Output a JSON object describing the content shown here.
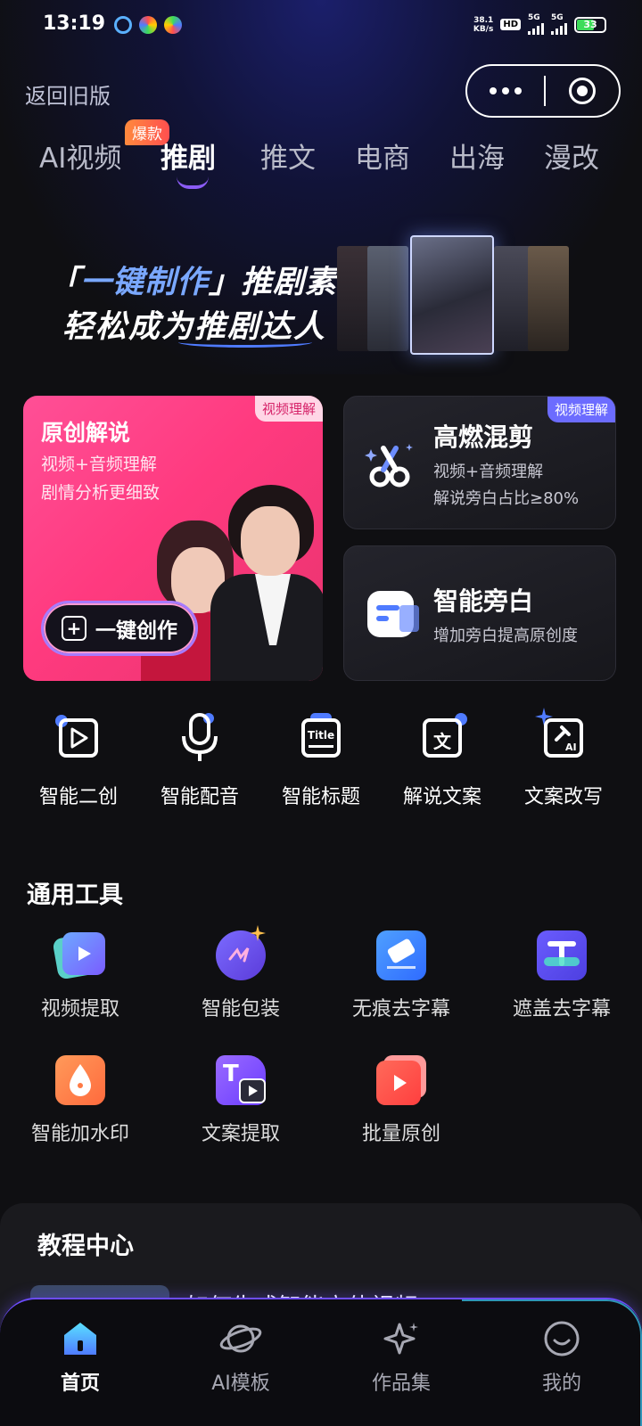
{
  "status_bar": {
    "time": "13:19",
    "net_speed_value": "38.1",
    "net_speed_unit": "KB/s",
    "hd_label": "HD",
    "hd_sub": "1 2",
    "signal1_label": "5G",
    "signal2_label": "5G",
    "battery_level": "33"
  },
  "header": {
    "back_label": "返回旧版"
  },
  "tabs": [
    {
      "label": "AI视频"
    },
    {
      "label": "推剧"
    },
    {
      "label": "推文"
    },
    {
      "label": "电商"
    },
    {
      "label": "出海"
    },
    {
      "label": "漫改"
    }
  ],
  "hot_badge": "爆款",
  "hero": {
    "line1_bracket_open": "「",
    "line1_highlight": "一键制作",
    "line1_bracket_close": "」",
    "line1_rest": "推剧素材",
    "line2": "轻松成为推剧达人"
  },
  "cards": {
    "original": {
      "title": "原创解说",
      "line1": "视频+音频理解",
      "line2": "剧情分析更细致",
      "tag": "视频理解",
      "button": "一键创作"
    },
    "mix": {
      "title": "高燃混剪",
      "line1": "视频+音频理解",
      "line2": "解说旁白占比≥80%",
      "tag": "视频理解"
    },
    "voice": {
      "title": "智能旁白",
      "line1": "增加旁白提高原创度"
    }
  },
  "quick_tools": [
    {
      "label": "智能二创",
      "icon": "video-edit-icon"
    },
    {
      "label": "智能配音",
      "icon": "microphone-icon"
    },
    {
      "label": "智能标题",
      "icon": "title-icon",
      "icon_text": "Title"
    },
    {
      "label": "解说文案",
      "icon": "text-doc-icon",
      "icon_text": "文"
    },
    {
      "label": "文案改写",
      "icon": "ai-rewrite-icon",
      "icon_text": "AI"
    }
  ],
  "general_tools": {
    "title": "通用工具",
    "items": [
      {
        "label": "视频提取",
        "icon": "video-extract-icon"
      },
      {
        "label": "智能包装",
        "icon": "smart-package-icon"
      },
      {
        "label": "无痕去字幕",
        "icon": "eraser-icon"
      },
      {
        "label": "遮盖去字幕",
        "icon": "cover-subtitle-icon"
      },
      {
        "label": "智能加水印",
        "icon": "watermark-icon"
      },
      {
        "label": "文案提取",
        "icon": "text-extract-icon"
      },
      {
        "label": "批量原创",
        "icon": "batch-original-icon"
      }
    ]
  },
  "tutorial": {
    "title": "教程中心",
    "item_title": "如何生成智能立体视频"
  },
  "bottom_nav": [
    {
      "label": "首页",
      "icon": "home-icon"
    },
    {
      "label": "AI模板",
      "icon": "planet-icon"
    },
    {
      "label": "作品集",
      "icon": "sparkle-icon"
    },
    {
      "label": "我的",
      "icon": "smile-icon"
    }
  ],
  "colors": {
    "accent_purple": "#8b5cf6",
    "card_pink": "#ff3a7f",
    "tag_blue": "#6c6cff",
    "background": "#0f0f12"
  }
}
